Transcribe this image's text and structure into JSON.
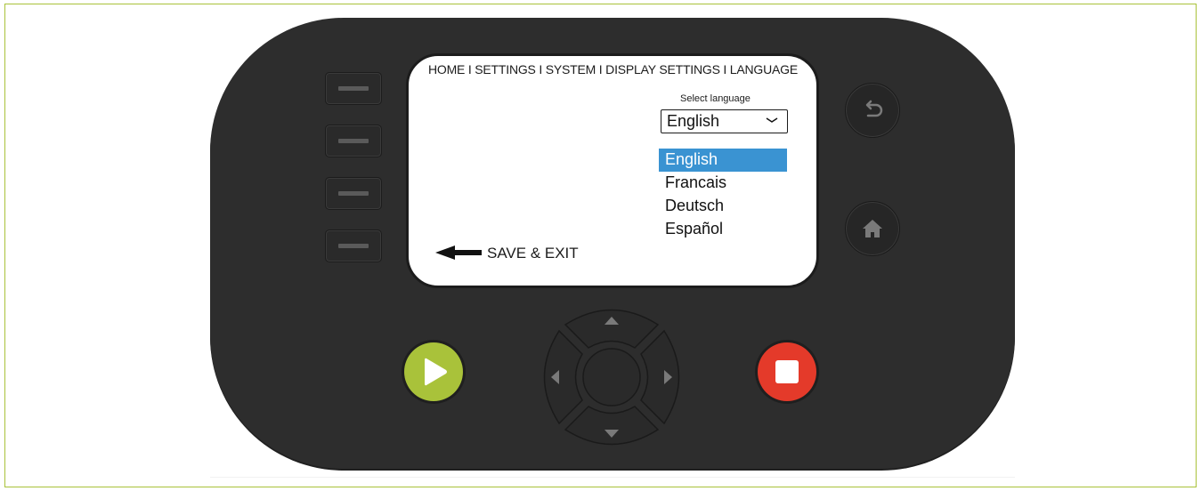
{
  "screen": {
    "breadcrumb": "HOME I SETTINGS I SYSTEM I DISPLAY SETTINGS I LANGUAGE",
    "select_label": "Select language",
    "selected_value": "English",
    "options": [
      {
        "label": "English",
        "selected": true
      },
      {
        "label": "Francais",
        "selected": false
      },
      {
        "label": "Deutsch",
        "selected": false
      },
      {
        "label": "Español",
        "selected": false
      }
    ],
    "save_exit_label": "SAVE & EXIT"
  },
  "colors": {
    "device_body": "#2d2d2d",
    "frame_border": "#a9c23a",
    "play": "#a9c23a",
    "stop": "#e43a2a",
    "selection": "#3a93d2"
  },
  "icons": {
    "back": "back-arrow-icon",
    "home": "home-icon",
    "play": "play-icon",
    "stop": "stop-icon",
    "dpad_up": "triangle-up-icon",
    "dpad_down": "triangle-down-icon",
    "dpad_left": "triangle-left-icon",
    "dpad_right": "triangle-right-icon"
  }
}
